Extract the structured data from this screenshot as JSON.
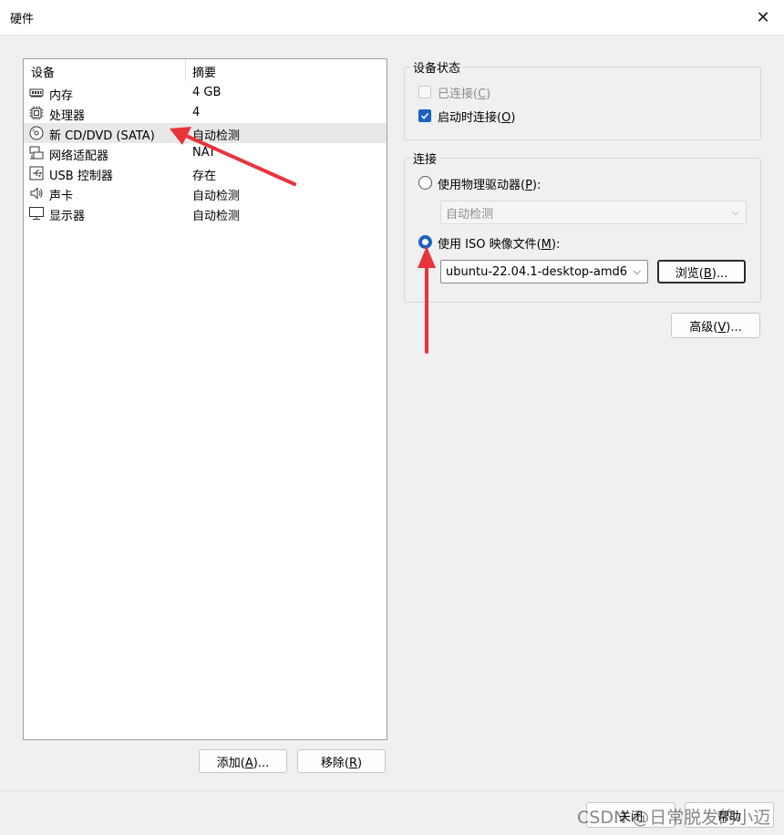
{
  "window": {
    "title": "硬件"
  },
  "icons": {
    "close": "close-icon",
    "ram": "ram-icon",
    "cpu": "cpu-icon",
    "cd": "cd-icon",
    "network": "network-icon",
    "usb": "usb-icon",
    "sound": "speaker-icon",
    "display": "monitor-icon"
  },
  "device_list": {
    "headers": {
      "device": "设备",
      "summary": "摘要"
    },
    "rows": [
      {
        "name": "内存",
        "summary": "4 GB"
      },
      {
        "name": "处理器",
        "summary": "4"
      },
      {
        "name": "新 CD/DVD (SATA)",
        "summary": "自动检测",
        "selected": true
      },
      {
        "name": "网络适配器",
        "summary": "NAT"
      },
      {
        "name": "USB 控制器",
        "summary": "存在"
      },
      {
        "name": "声卡",
        "summary": "自动检测"
      },
      {
        "name": "显示器",
        "summary": "自动检测"
      }
    ]
  },
  "buttons": {
    "add": {
      "prefix": "添加(",
      "key": "A",
      "suffix": ")..."
    },
    "remove": {
      "prefix": "移除(",
      "key": "R",
      "suffix": ")"
    },
    "browse": {
      "prefix": "浏览(",
      "key": "B",
      "suffix": ")..."
    },
    "advanced": {
      "prefix": "高级(",
      "key": "V",
      "suffix": ")..."
    },
    "close": "关闭",
    "help": "帮助"
  },
  "device_status": {
    "title": "设备状态",
    "connected": {
      "prefix": "已连接(",
      "key": "C",
      "suffix": ")",
      "checked": false,
      "enabled": false
    },
    "connect_at_power_on": {
      "prefix": "启动时连接(",
      "key": "O",
      "suffix": ")",
      "checked": true,
      "enabled": true
    }
  },
  "connection": {
    "title": "连接",
    "physical": {
      "prefix": "使用物理驱动器(",
      "key": "P",
      "suffix": "):",
      "selected": false
    },
    "physical_value": "自动检测",
    "iso": {
      "prefix": "使用 ISO 映像文件(",
      "key": "M",
      "suffix": "):",
      "selected": true
    },
    "iso_value": "ubuntu-22.04.1-desktop-amd6"
  },
  "annotation_color": "#e8343c",
  "accent_color": "#1a63c1",
  "watermark": "CSDN @日常脱发的小迈"
}
